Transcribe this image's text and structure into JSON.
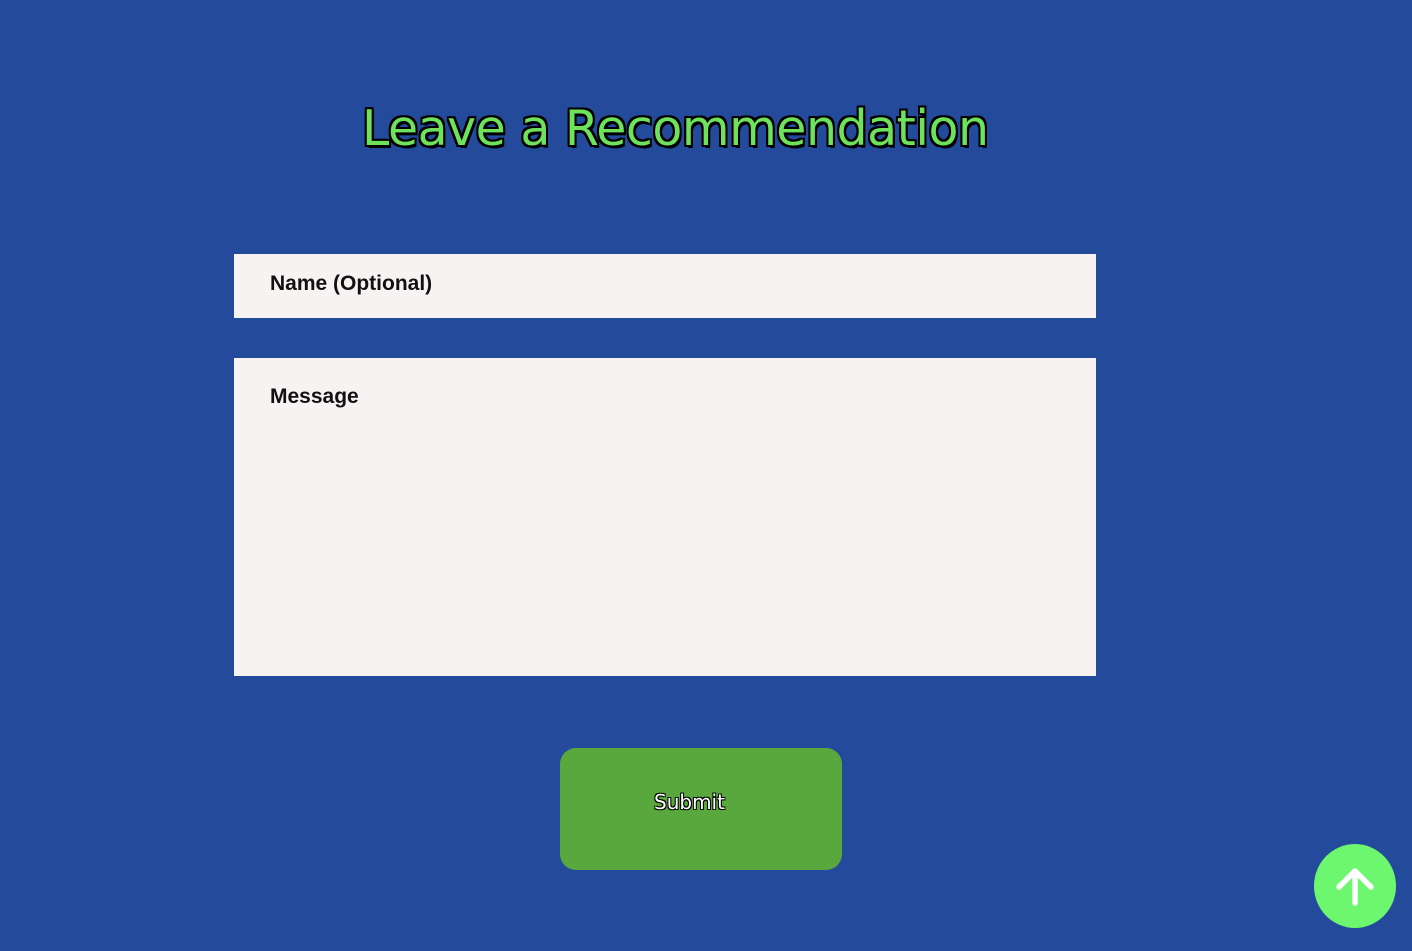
{
  "page": {
    "title": "Leave a Recommendation"
  },
  "form": {
    "name_placeholder": "Name (Optional)",
    "message_placeholder": "Message",
    "submit_label": "Submit"
  },
  "scroll_top": {
    "icon": "arrow-up-icon"
  },
  "colors": {
    "background": "#244b9b",
    "title": "#6fe25c",
    "field_background": "#f8f3f3",
    "submit_button": "#58a83d",
    "scroll_top_button": "#6df76e"
  }
}
